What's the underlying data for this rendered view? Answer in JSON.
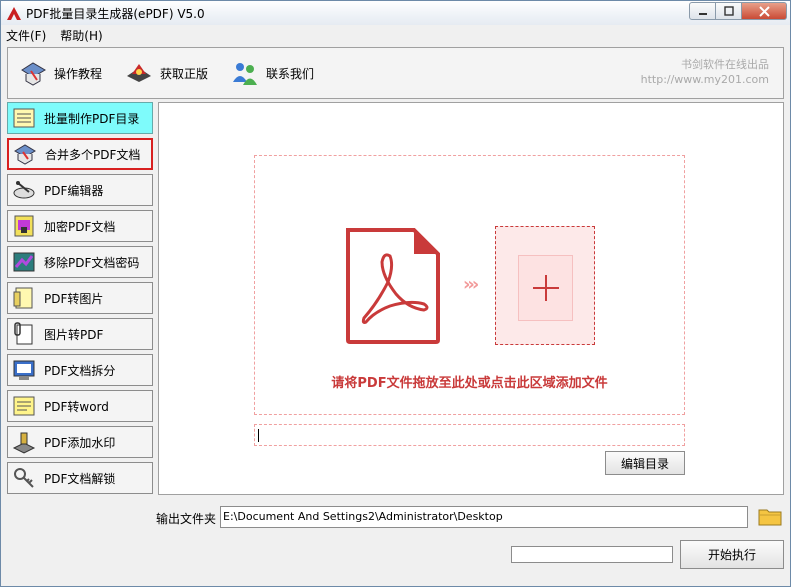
{
  "window": {
    "title": "PDF批量目录生成器(ePDF) V5.0",
    "controls": [
      "minimize",
      "maximize",
      "close"
    ]
  },
  "menu": {
    "items": [
      {
        "label": "文件(F)"
      },
      {
        "label": "帮助(H)"
      }
    ]
  },
  "toolbar": {
    "buttons": [
      {
        "label": "操作教程",
        "icon": "tutorial-icon"
      },
      {
        "label": "获取正版",
        "icon": "get-license-icon"
      },
      {
        "label": "联系我们",
        "icon": "contact-us-icon"
      }
    ],
    "brand_line1": "书剑软件在线出品",
    "brand_line2": "http://www.my201.com"
  },
  "sidebar": {
    "items": [
      {
        "label": "批量制作PDF目录",
        "icon": "notepad-icon",
        "state": "active"
      },
      {
        "label": "合并多个PDF文档",
        "icon": "merge-icon",
        "state": "selected"
      },
      {
        "label": "PDF编辑器",
        "icon": "editor-icon",
        "state": "normal"
      },
      {
        "label": "加密PDF文档",
        "icon": "encrypt-icon",
        "state": "normal"
      },
      {
        "label": "移除PDF文档密码",
        "icon": "remove-password-icon",
        "state": "normal"
      },
      {
        "label": "PDF转图片",
        "icon": "pdf-to-image-icon",
        "state": "normal"
      },
      {
        "label": "图片转PDF",
        "icon": "image-to-pdf-icon",
        "state": "normal"
      },
      {
        "label": "PDF文档拆分",
        "icon": "split-icon",
        "state": "normal"
      },
      {
        "label": "PDF转word",
        "icon": "pdf-to-word-icon",
        "state": "normal"
      },
      {
        "label": "PDF添加水印",
        "icon": "watermark-icon",
        "state": "normal"
      },
      {
        "label": "PDF文档解锁",
        "icon": "unlock-icon",
        "state": "normal"
      }
    ]
  },
  "main": {
    "drop_text": "请将PDF文件拖放至此处或点击此区域添加文件",
    "arrows": "›››",
    "path_input_value": "",
    "edit_button_label": "编辑目录"
  },
  "output": {
    "label": "输出文件夹",
    "path": "E:\\Document And Settings2\\Administrator\\Desktop"
  },
  "progress": {
    "value": 0
  },
  "start_button_label": "开始执行",
  "colors": {
    "accent_red": "#c93a3a",
    "active_cyan": "#7efbfb",
    "selected_border": "#d82020",
    "brand_gray": "#a9a9a9"
  }
}
